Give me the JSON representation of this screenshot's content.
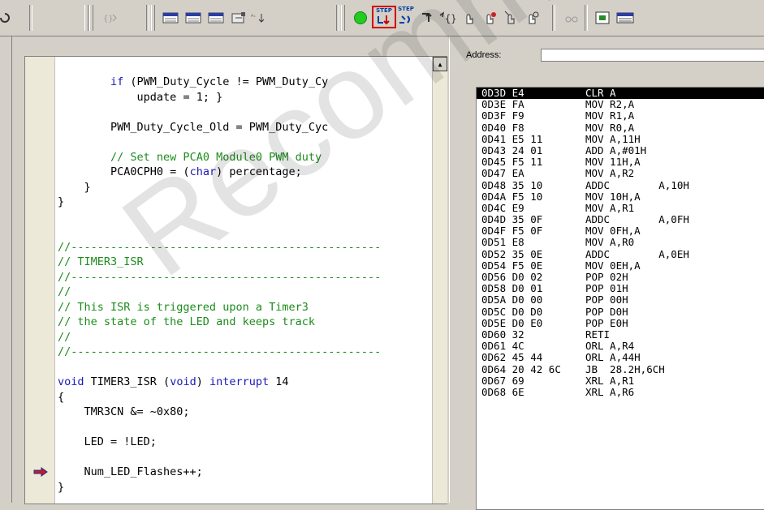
{
  "toolbar": {
    "buttons": [
      {
        "icon": "reset-icon"
      },
      {
        "icon": "breakpoint-list-icon"
      },
      {
        "icon": "memory-window-icon"
      },
      {
        "icon": "watch-window-icon"
      },
      {
        "icon": "registers-icon"
      },
      {
        "icon": "disassembly-icon"
      },
      {
        "icon": "sort-icon"
      },
      {
        "icon": "run-icon"
      },
      {
        "icon": "step-into-icon",
        "label": "STEP"
      },
      {
        "icon": "step-over-icon",
        "label": "STEP"
      },
      {
        "icon": "step-out-icon"
      },
      {
        "icon": "run-to-cursor-icon"
      },
      {
        "icon": "insert-breakpoint-icon"
      },
      {
        "icon": "remove-breakpoint-icon"
      },
      {
        "icon": "enable-breakpoint-icon"
      },
      {
        "icon": "disable-breakpoint-icon"
      },
      {
        "icon": "watch-glasses-icon"
      },
      {
        "icon": "chip-icon"
      },
      {
        "icon": "file-icon"
      }
    ],
    "highlight_color": "#d00000",
    "run_color": "#22cc22"
  },
  "code": {
    "lines": [
      {
        "indent": "        ",
        "parts": [
          {
            "t": "if",
            "c": "kw"
          },
          {
            "t": " (PWM_Duty_Cycle != PWM_Duty_Cy"
          }
        ]
      },
      {
        "indent": "            ",
        "parts": [
          {
            "t": "update = 1; }"
          }
        ]
      },
      {
        "indent": "",
        "parts": []
      },
      {
        "indent": "        ",
        "parts": [
          {
            "t": "PWM_Duty_Cycle_Old = PWM_Duty_Cyc"
          }
        ]
      },
      {
        "indent": "",
        "parts": []
      },
      {
        "indent": "        ",
        "parts": [
          {
            "t": "// Set new PCA0 Module0 PWM duty",
            "c": "cm"
          }
        ]
      },
      {
        "indent": "        ",
        "parts": [
          {
            "t": "PCA0CPH0 = ("
          },
          {
            "t": "char",
            "c": "kw"
          },
          {
            "t": ") percentage;"
          }
        ]
      },
      {
        "indent": "    ",
        "parts": [
          {
            "t": "}"
          }
        ]
      },
      {
        "indent": "",
        "parts": [
          {
            "t": "}"
          }
        ]
      },
      {
        "indent": "",
        "parts": []
      },
      {
        "indent": "",
        "parts": []
      },
      {
        "indent": "",
        "parts": [
          {
            "t": "//-----------------------------------------------",
            "c": "cm"
          }
        ]
      },
      {
        "indent": "",
        "parts": [
          {
            "t": "// TIMER3_ISR",
            "c": "cm"
          }
        ]
      },
      {
        "indent": "",
        "parts": [
          {
            "t": "//-----------------------------------------------",
            "c": "cm"
          }
        ]
      },
      {
        "indent": "",
        "parts": [
          {
            "t": "//",
            "c": "cm"
          }
        ]
      },
      {
        "indent": "",
        "parts": [
          {
            "t": "// This ISR is triggered upon a Timer3",
            "c": "cm"
          }
        ]
      },
      {
        "indent": "",
        "parts": [
          {
            "t": "// the state of the LED and keeps track",
            "c": "cm"
          }
        ]
      },
      {
        "indent": "",
        "parts": [
          {
            "t": "//",
            "c": "cm"
          }
        ]
      },
      {
        "indent": "",
        "parts": [
          {
            "t": "//-----------------------------------------------",
            "c": "cm"
          }
        ]
      },
      {
        "indent": "",
        "parts": []
      },
      {
        "indent": "",
        "parts": [
          {
            "t": "void",
            "c": "kw"
          },
          {
            "t": " TIMER3_ISR ("
          },
          {
            "t": "void",
            "c": "kw"
          },
          {
            "t": ") "
          },
          {
            "t": "interrupt",
            "c": "kw"
          },
          {
            "t": " 14"
          }
        ]
      },
      {
        "indent": "",
        "parts": [
          {
            "t": "{"
          }
        ]
      },
      {
        "indent": "    ",
        "parts": [
          {
            "t": "TMR3CN &= ~0x80;"
          }
        ]
      },
      {
        "indent": "",
        "parts": []
      },
      {
        "indent": "    ",
        "parts": [
          {
            "t": "LED = !LED;"
          }
        ]
      },
      {
        "indent": "",
        "parts": []
      },
      {
        "indent": "    ",
        "parts": [
          {
            "t": "Num_LED_Flashes++;"
          }
        ]
      },
      {
        "indent": "",
        "parts": [
          {
            "t": "}"
          }
        ]
      }
    ],
    "exec_line": 26
  },
  "disasm": {
    "address_label": "Address:",
    "address_value": "",
    "lines": [
      {
        "addr": "0D3D",
        "bytes": "E4",
        "ins": "CLR A",
        "sel": true
      },
      {
        "addr": "0D3E",
        "bytes": "FA",
        "ins": "MOV R2,A"
      },
      {
        "addr": "0D3F",
        "bytes": "F9",
        "ins": "MOV R1,A"
      },
      {
        "addr": "0D40",
        "bytes": "F8",
        "ins": "MOV R0,A"
      },
      {
        "addr": "0D41",
        "bytes": "E5 11",
        "ins": "MOV A,11H"
      },
      {
        "addr": "0D43",
        "bytes": "24 01",
        "ins": "ADD A,#01H"
      },
      {
        "addr": "0D45",
        "bytes": "F5 11",
        "ins": "MOV 11H,A"
      },
      {
        "addr": "0D47",
        "bytes": "EA",
        "ins": "MOV A,R2"
      },
      {
        "addr": "0D48",
        "bytes": "35 10",
        "ins": "ADDC        A,10H"
      },
      {
        "addr": "0D4A",
        "bytes": "F5 10",
        "ins": "MOV 10H,A"
      },
      {
        "addr": "0D4C",
        "bytes": "E9",
        "ins": "MOV A,R1"
      },
      {
        "addr": "0D4D",
        "bytes": "35 0F",
        "ins": "ADDC        A,0FH"
      },
      {
        "addr": "0D4F",
        "bytes": "F5 0F",
        "ins": "MOV 0FH,A"
      },
      {
        "addr": "0D51",
        "bytes": "E8",
        "ins": "MOV A,R0"
      },
      {
        "addr": "0D52",
        "bytes": "35 0E",
        "ins": "ADDC        A,0EH"
      },
      {
        "addr": "0D54",
        "bytes": "F5 0E",
        "ins": "MOV 0EH,A"
      },
      {
        "addr": "0D56",
        "bytes": "D0 02",
        "ins": "POP 02H"
      },
      {
        "addr": "0D58",
        "bytes": "D0 01",
        "ins": "POP 01H"
      },
      {
        "addr": "0D5A",
        "bytes": "D0 00",
        "ins": "POP 00H"
      },
      {
        "addr": "0D5C",
        "bytes": "D0 D0",
        "ins": "POP D0H"
      },
      {
        "addr": "0D5E",
        "bytes": "D0 E0",
        "ins": "POP E0H"
      },
      {
        "addr": "0D60",
        "bytes": "32",
        "ins": "RETI"
      },
      {
        "addr": "0D61",
        "bytes": "4C",
        "ins": "ORL A,R4"
      },
      {
        "addr": "0D62",
        "bytes": "45 44",
        "ins": "ORL A,44H"
      },
      {
        "addr": "0D64",
        "bytes": "20 42 6C",
        "ins": "JB  28.2H,6CH"
      },
      {
        "addr": "0D67",
        "bytes": "69",
        "ins": "XRL A,R1"
      },
      {
        "addr": "0D68",
        "bytes": "6E",
        "ins": "XRL A,R6"
      }
    ]
  },
  "watermark": "Recommended for New"
}
